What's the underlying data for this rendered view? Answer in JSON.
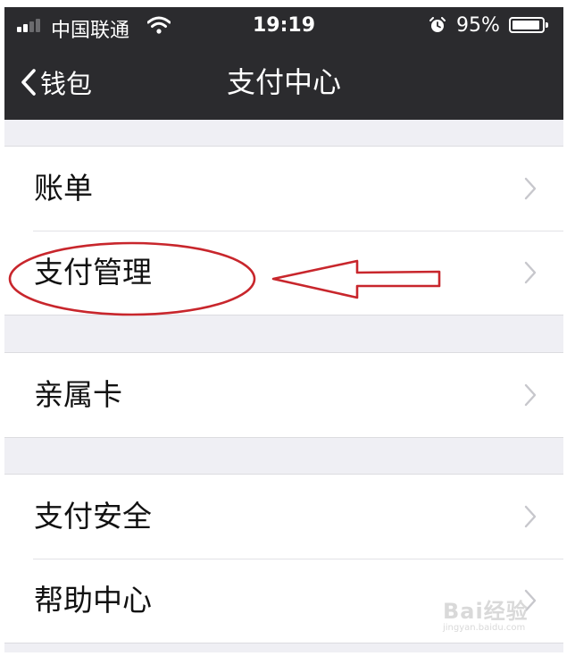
{
  "status_bar": {
    "carrier": "中国联通",
    "time": "19:19",
    "battery_percent": "95%",
    "battery_level": 0.95,
    "signal_bars": 2
  },
  "nav": {
    "back_label": "钱包",
    "title": "支付中心"
  },
  "groups": [
    {
      "items": [
        {
          "label": "账单"
        },
        {
          "label": "支付管理"
        }
      ]
    },
    {
      "items": [
        {
          "label": "亲属卡"
        }
      ]
    },
    {
      "items": [
        {
          "label": "支付安全"
        },
        {
          "label": "帮助中心"
        }
      ]
    }
  ],
  "annotation": {
    "highlighted_item": "支付管理",
    "color": "#c8262c"
  },
  "watermark": {
    "main": "Bai经验",
    "sub": "jingyan.baidu.com"
  },
  "colors": {
    "bar_background": "#2b2b2e",
    "page_background": "#efeff4",
    "cell_background": "#ffffff",
    "chevron": "#c7c7cc"
  }
}
